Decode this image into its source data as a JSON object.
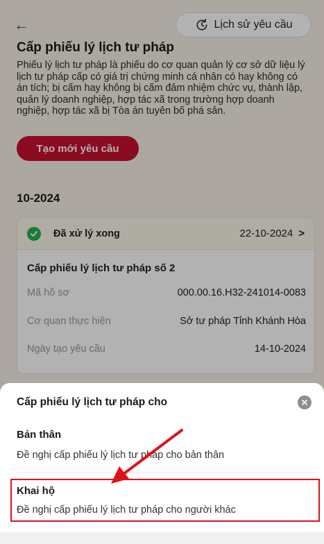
{
  "header": {
    "back_glyph": "←",
    "history_label": "Lịch sử yêu cầu"
  },
  "page": {
    "title": "Cấp phiếu lý lịch tư pháp",
    "description": "Phiếu lý lịch tư pháp là phiếu do cơ quan quản lý cơ sở dữ liệu lý lịch tư pháp cấp có giá trị chứng minh cá nhân có hay không có án tích; bị cấm hay không bị cấm đảm nhiệm chức vụ, thành lập, quản lý doanh nghiệp, hợp tác xã trong trường hợp doanh nghiệp, hợp tác xã bị Tòa án tuyên bố phá sản.",
    "create_label": "Tạo mới yêu cầu",
    "month": "10-2024"
  },
  "card": {
    "status": "Đã xử lý xong",
    "status_date": "22-10-2024",
    "chevron": ">",
    "title": "Cấp phiếu lý lịch tư pháp số 2",
    "rows": [
      {
        "label": "Mã hồ sơ",
        "value": "000.00.16.H32-241014-0083"
      },
      {
        "label": "Cơ quan thực hiện",
        "value": "Sở tư pháp Tỉnh Khánh Hòa"
      },
      {
        "label": "Ngày tạo yêu cầu",
        "value": "14-10-2024"
      }
    ]
  },
  "sheet": {
    "title": "Cấp phiếu lý lịch tư pháp cho",
    "options": [
      {
        "title": "Bản thân",
        "desc": "Đề nghị cấp phiếu lý lịch tư pháp cho bản thân"
      },
      {
        "title": "Khai hộ",
        "desc": "Đề nghị cấp phiếu lý lịch tư pháp cho người khác"
      }
    ]
  },
  "colors": {
    "accent_red": "#c8102e",
    "success_green": "#22b24c",
    "highlight_red": "#e0101a"
  },
  "icons": {
    "back": "arrow-left-icon",
    "history": "history-icon",
    "status": "check-circle-icon",
    "close": "close-icon"
  }
}
